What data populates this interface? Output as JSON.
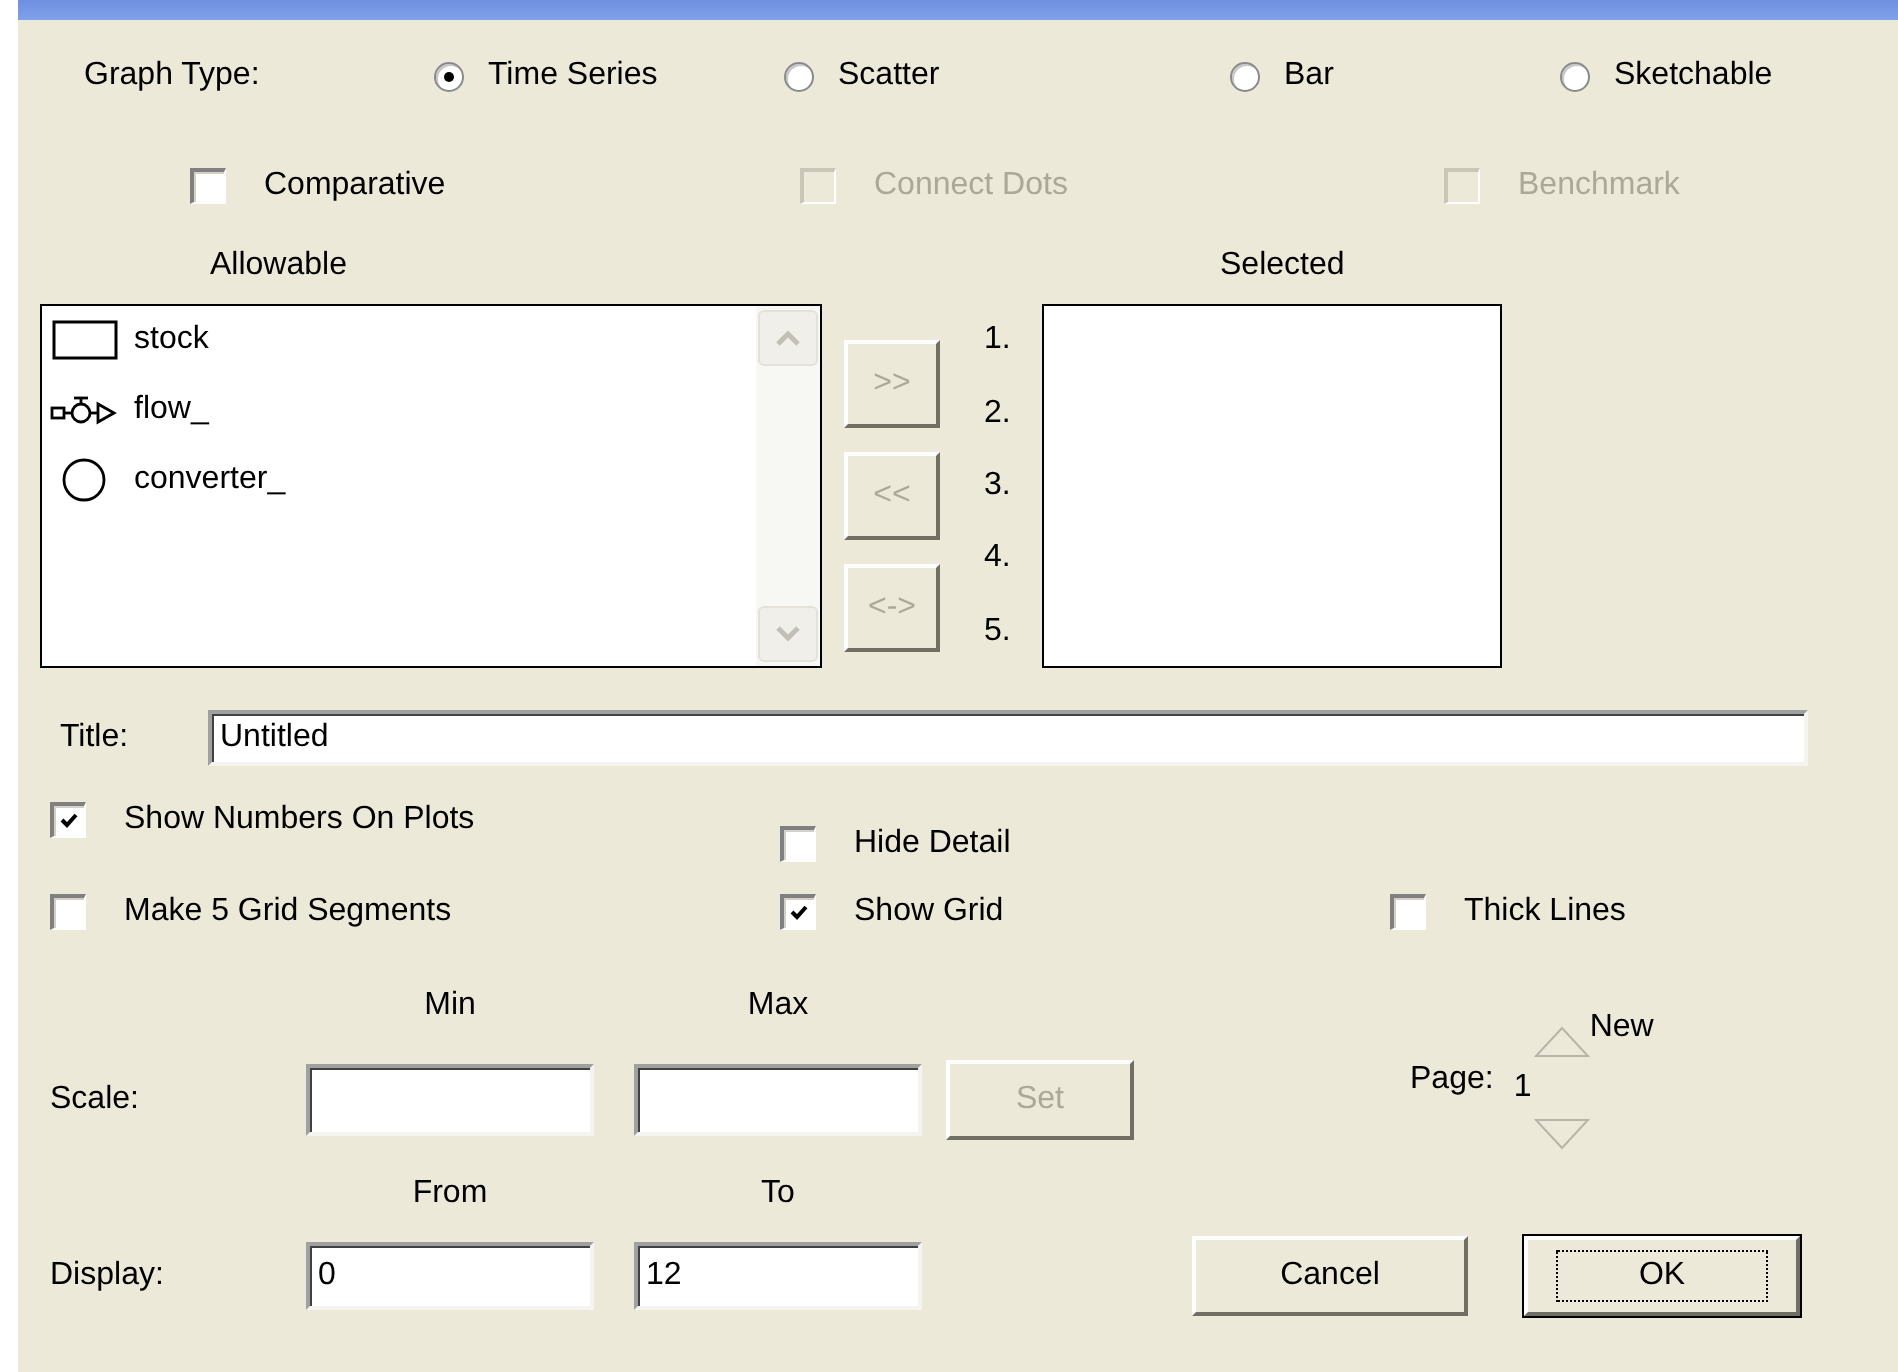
{
  "graph_type": {
    "label": "Graph Type:",
    "options": [
      {
        "label": "Time Series",
        "selected": true
      },
      {
        "label": "Scatter",
        "selected": false
      },
      {
        "label": "Bar",
        "selected": false
      },
      {
        "label": "Sketchable",
        "selected": false
      }
    ]
  },
  "graph_flags": [
    {
      "label": "Comparative",
      "checked": false,
      "disabled": false
    },
    {
      "label": "Connect Dots",
      "checked": false,
      "disabled": true
    },
    {
      "label": "Benchmark",
      "checked": false,
      "disabled": true
    }
  ],
  "allowable": {
    "heading": "Allowable",
    "items": [
      {
        "label": "stock",
        "kind": "stock"
      },
      {
        "label": "flow_",
        "kind": "flow"
      },
      {
        "label": "converter_",
        "kind": "converter"
      }
    ]
  },
  "transfer_buttons": [
    {
      "label": ">>",
      "disabled": true
    },
    {
      "label": "<<",
      "disabled": true
    },
    {
      "label": "<->",
      "disabled": true
    }
  ],
  "slot_numbers": [
    "1.",
    "2.",
    "3.",
    "4.",
    "5."
  ],
  "selected": {
    "heading": "Selected"
  },
  "title": {
    "label": "Title:",
    "value": "Untitled"
  },
  "plot_options": [
    [
      {
        "label": "Show Numbers On Plots",
        "checked": true
      },
      {
        "label": "Hide Detail",
        "checked": false
      }
    ],
    [
      {
        "label": "Make 5 Grid Segments",
        "checked": false
      },
      {
        "label": "Show Grid",
        "checked": true
      },
      {
        "label": "Thick Lines",
        "checked": false
      }
    ]
  ],
  "scale": {
    "label": "Scale:",
    "min_label": "Min",
    "max_label": "Max",
    "set_button": {
      "label": "Set",
      "disabled": true
    }
  },
  "page": {
    "label": "Page:",
    "value": "1",
    "new_label": "New"
  },
  "display": {
    "label": "Display:",
    "from_label": "From",
    "to_label": "To",
    "from_value": "0",
    "to_value": "12"
  },
  "buttons": [
    {
      "label": "Cancel",
      "default": false
    },
    {
      "label": "OK",
      "default": true
    }
  ]
}
